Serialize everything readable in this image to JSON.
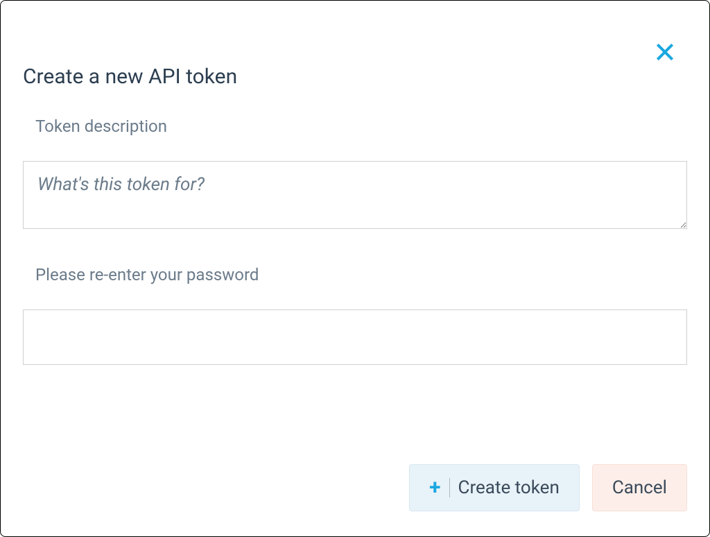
{
  "modal": {
    "title": "Create a new API token",
    "description_label": "Token description",
    "description_placeholder": "What's this token for?",
    "description_value": "",
    "password_label": "Please re-enter your password",
    "password_value": "",
    "create_button_label": "Create token",
    "cancel_button_label": "Cancel"
  }
}
